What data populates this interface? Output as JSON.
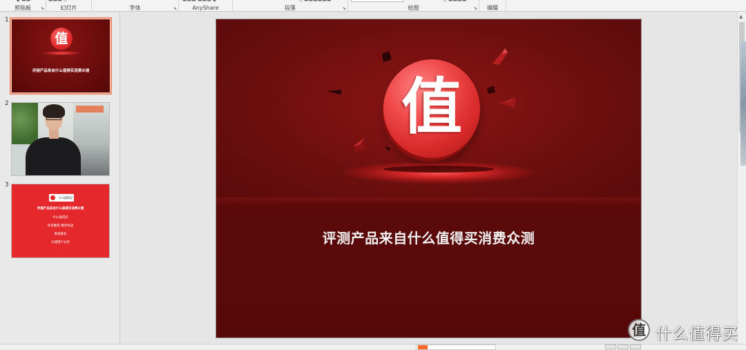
{
  "ribbon": {
    "groups": [
      {
        "label": "剪贴板"
      },
      {
        "label": "幻灯片"
      },
      {
        "label": "字体"
      },
      {
        "label": "AnyShare"
      },
      {
        "label": "段落"
      },
      {
        "label": "绘图"
      },
      {
        "label": "编辑"
      }
    ]
  },
  "slides_panel": {
    "slides": [
      {
        "number": "1",
        "caption": "评测产品来自什么值得买消费众测",
        "badge": "值"
      },
      {
        "number": "2"
      },
      {
        "number": "3",
        "lines": [
          "评测产品来自什么值得买消费众测",
          "什么值得买",
          "好货推荐 精评优选",
          "客观真实",
          "众测用户分享"
        ]
      }
    ]
  },
  "slide": {
    "badge_char": "值",
    "title": "评测产品来自什么值得买消费众测"
  },
  "watermark": {
    "badge": "值",
    "text": "什么值得买"
  },
  "colors": {
    "slide_bg": "#5f0c0c",
    "badge_red": "#e03030",
    "selection_border": "#f08a6a",
    "slide3_bg": "#e5282b"
  }
}
